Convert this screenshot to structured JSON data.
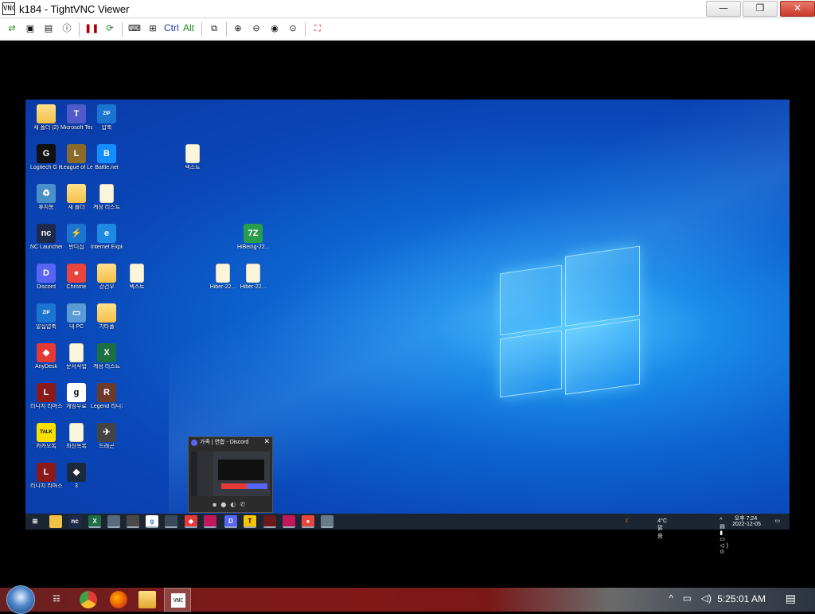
{
  "window": {
    "title": "k184 - TightVNC Viewer",
    "app_icon_text": "VNC",
    "minimize_glyph": "—",
    "maximize_glyph": "❐",
    "close_glyph": "✕"
  },
  "toolbar": {
    "buttons": [
      "new-connection",
      "save",
      "options",
      "info",
      "pause",
      "refresh",
      "send-ctrl-alt-del",
      "send-ctrl-esc",
      "ctrl",
      "alt",
      "copy-clipboard",
      "zoom-in",
      "zoom-out",
      "zoom-100",
      "zoom-auto",
      "fullscreen"
    ],
    "ctrl_label": "Ctrl",
    "alt_label": "Alt"
  },
  "remote_desktop": {
    "icons": [
      {
        "label": "새 폴더 (2)",
        "type": "folder",
        "icon": "folder-icon"
      },
      {
        "label": "Microsoft Teams",
        "type": "app",
        "color": "#5059c9",
        "glyph": "T",
        "icon": "teams-icon"
      },
      {
        "label": "압축",
        "type": "zip",
        "color": "#1b75d0",
        "glyph": "ZIP",
        "icon": "zip-icon"
      },
      {
        "label": "Logitech G HUB",
        "type": "app",
        "color": "#111111",
        "glyph": "G",
        "icon": "ghub-icon"
      },
      {
        "label": "League of Legends",
        "type": "app",
        "color": "#8c6b2a",
        "glyph": "L",
        "icon": "lol-icon"
      },
      {
        "label": "Battle.net",
        "type": "app",
        "color": "#148eff",
        "glyph": "B",
        "icon": "battlenet-icon"
      },
      {
        "label": "텍스트",
        "type": "doc",
        "icon": "document-icon"
      },
      {
        "label": "휴지통",
        "type": "app",
        "color": "#4a90c8",
        "glyph": "♻",
        "icon": "recycle-bin-icon"
      },
      {
        "label": "새 폴더",
        "type": "folder",
        "icon": "folder-icon"
      },
      {
        "label": "계정 리스트",
        "type": "doc",
        "icon": "document-icon"
      },
      {
        "label": "NC Launcher 2",
        "type": "app",
        "color": "#1e2a4a",
        "glyph": "nc",
        "icon": "nc-launcher-icon"
      },
      {
        "label": "반디집",
        "type": "app",
        "color": "#1b75d0",
        "glyph": "⚡",
        "icon": "bandizip-icon"
      },
      {
        "label": "Internet Explorer",
        "type": "app",
        "color": "#1e88e5",
        "glyph": "e",
        "icon": "ie-icon"
      },
      {
        "label": "HiBeing-22...",
        "type": "app",
        "color": "#2a9d4a",
        "glyph": "7Z",
        "icon": "7z-icon"
      },
      {
        "label": "Discord",
        "type": "app",
        "color": "#5865f2",
        "glyph": "D",
        "icon": "discord-icon"
      },
      {
        "label": "Chrome",
        "type": "app",
        "color": "#e8453c",
        "glyph": "●",
        "icon": "chrome-icon"
      },
      {
        "label": "강건우",
        "type": "folder",
        "icon": "folder-user-icon"
      },
      {
        "label": "텍스트",
        "type": "doc",
        "icon": "document-icon"
      },
      {
        "label": "Hiber-22...",
        "type": "doc",
        "icon": "document-icon"
      },
      {
        "label": "Hiber-22...",
        "type": "doc",
        "icon": "document-icon"
      },
      {
        "label": "알집압축",
        "type": "zip",
        "color": "#1b75d0",
        "glyph": "ZIP",
        "icon": "zip-icon"
      },
      {
        "label": "내 PC",
        "type": "app",
        "color": "#5a9bd5",
        "glyph": "▭",
        "icon": "this-pc-icon"
      },
      {
        "label": "기타폴",
        "type": "folder",
        "icon": "folder-icon"
      },
      {
        "label": "AnyDesk",
        "type": "app",
        "color": "#e53935",
        "glyph": "◆",
        "icon": "anydesk-icon"
      },
      {
        "label": "문서작업",
        "type": "doc",
        "icon": "document-icon"
      },
      {
        "label": "계정 리스트",
        "type": "app",
        "color": "#1d6f42",
        "glyph": "X",
        "icon": "excel-icon"
      },
      {
        "label": "리니지 리마스터",
        "type": "app",
        "color": "#8b1a1a",
        "glyph": "L",
        "icon": "lineage-icon"
      },
      {
        "label": "게임무료",
        "type": "app",
        "color": "#ffffff",
        "glyph": "g",
        "icon": "game-icon"
      },
      {
        "label": "Legend 리니지",
        "type": "app",
        "color": "#6b3a2a",
        "glyph": "R",
        "icon": "legend-icon"
      },
      {
        "label": "카카오톡",
        "type": "app",
        "color": "#f9e000",
        "glyph": "TALK",
        "icon": "kakaotalk-icon"
      },
      {
        "label": "최신목록",
        "type": "doc",
        "icon": "document-icon"
      },
      {
        "label": "드래곤",
        "type": "app",
        "color": "#444444",
        "glyph": "✈",
        "icon": "dragon-icon"
      },
      {
        "label": "리니지 리마스터",
        "type": "app",
        "color": "#8b1a1a",
        "glyph": "L",
        "icon": "lineage-icon"
      },
      {
        "label": "3",
        "type": "app",
        "color": "#1a2a3a",
        "glyph": "◆",
        "icon": "app-icon"
      }
    ],
    "discord_preview": {
      "title": "가족 | 연합 - Discord"
    },
    "taskbar": {
      "weather": "4°C 맑음",
      "time": "오후 7:24",
      "date": "2022-12-05"
    }
  },
  "host_taskbar": {
    "time": "5:25:01 AM"
  }
}
